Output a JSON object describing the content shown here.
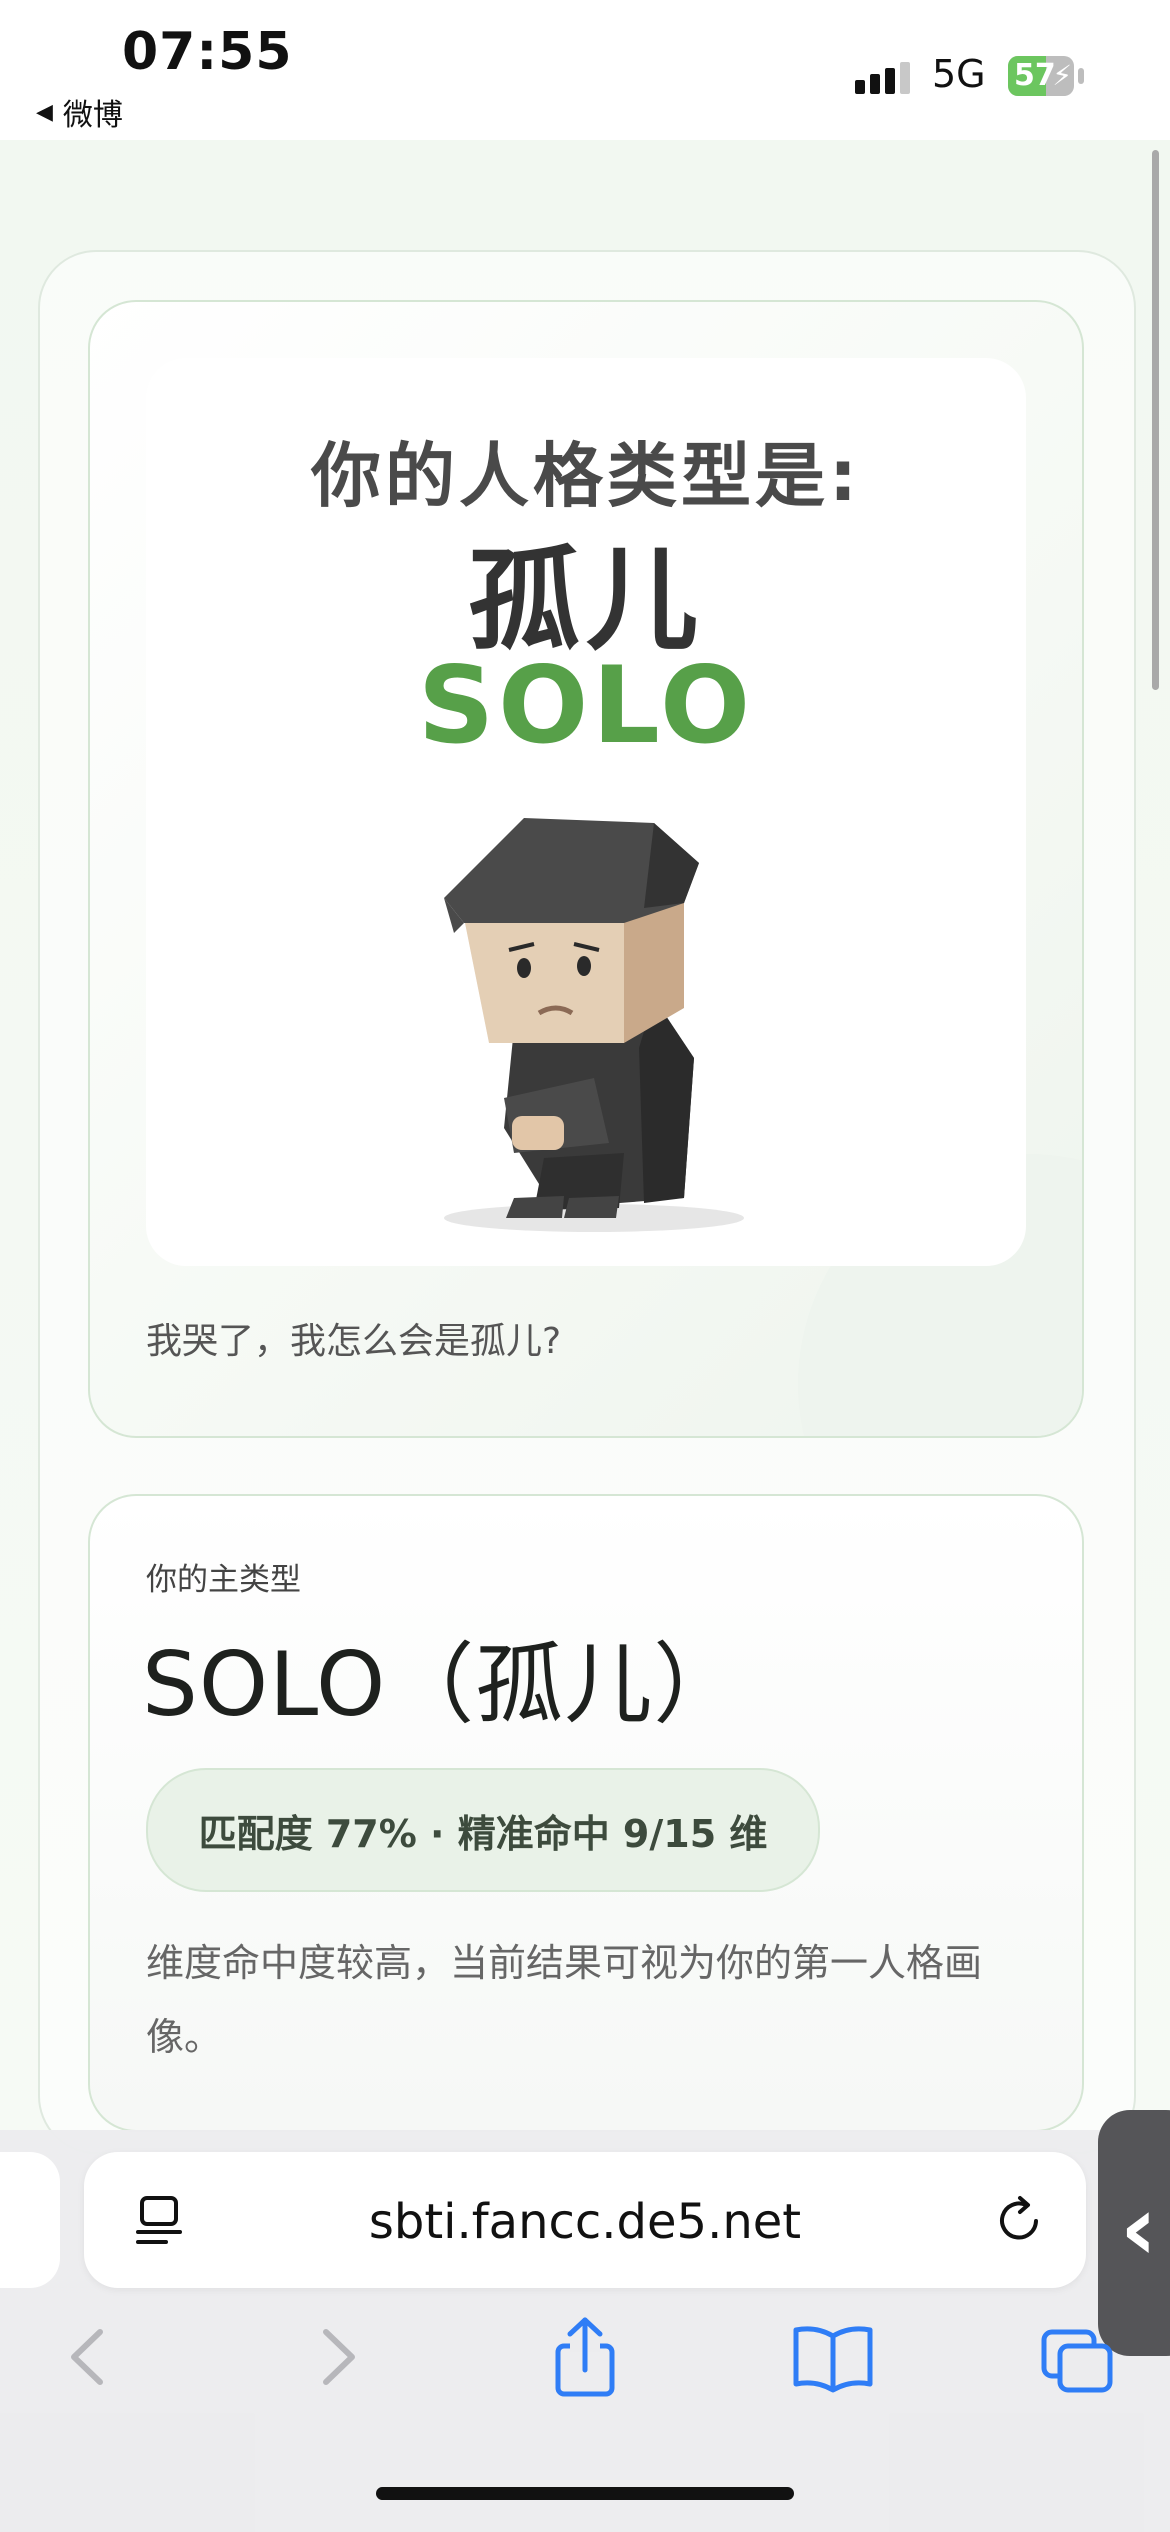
{
  "status_bar": {
    "time": "07:55",
    "back_app": "微博",
    "network": "5G",
    "battery": "57",
    "battery_level": 0.57
  },
  "hero": {
    "line1": "你的人格类型是:",
    "name": "孤儿",
    "code": "SOLO",
    "caption": "我哭了，我怎么会是孤儿?"
  },
  "type_card": {
    "eyebrow": "你的主类型",
    "title": "SOLO（孤儿）",
    "match": "匹配度 77% · 精准命中 9/15 维",
    "description": "维度命中度较高，当前结果可视为你的第一人格画像。"
  },
  "browser": {
    "url": "sbti.fancc.de5.net"
  },
  "colors": {
    "accent_green": "#57a049",
    "pill_bg": "#e9f2e8",
    "toolbar_blue": "#2f7df6"
  }
}
